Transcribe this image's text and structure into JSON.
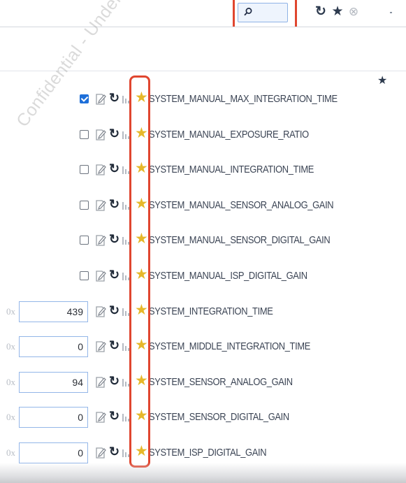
{
  "toolbar": {
    "search": {
      "value": "",
      "placeholder": ""
    },
    "icons": [
      "search-icon",
      "refresh-icon",
      "star-icon",
      "close-icon"
    ]
  },
  "watermark": "Confidential - Under NDA",
  "colors": {
    "accent": "#1e6fd9",
    "star": "#e6b82a",
    "highlight": "#e0462f",
    "text": "#3b4454"
  },
  "parameters": [
    {
      "type": "checkbox",
      "checked": true,
      "name": "SYSTEM_MANUAL_MAX_INTEGRATION_TIME"
    },
    {
      "type": "checkbox",
      "checked": false,
      "name": "SYSTEM_MANUAL_EXPOSURE_RATIO"
    },
    {
      "type": "checkbox",
      "checked": false,
      "name": "SYSTEM_MANUAL_INTEGRATION_TIME"
    },
    {
      "type": "checkbox",
      "checked": false,
      "name": "SYSTEM_MANUAL_SENSOR_ANALOG_GAIN"
    },
    {
      "type": "checkbox",
      "checked": false,
      "name": "SYSTEM_MANUAL_SENSOR_DIGITAL_GAIN"
    },
    {
      "type": "checkbox",
      "checked": false,
      "name": "SYSTEM_MANUAL_ISP_DIGITAL_GAIN"
    },
    {
      "type": "number",
      "prefix": "0x",
      "value": "439",
      "name": "SYSTEM_INTEGRATION_TIME"
    },
    {
      "type": "number",
      "prefix": "0x",
      "value": "0",
      "name": "SYSTEM_MIDDLE_INTEGRATION_TIME"
    },
    {
      "type": "number",
      "prefix": "0x",
      "value": "94",
      "name": "SYSTEM_SENSOR_ANALOG_GAIN"
    },
    {
      "type": "number",
      "prefix": "0x",
      "value": "0",
      "name": "SYSTEM_SENSOR_DIGITAL_GAIN"
    },
    {
      "type": "number",
      "prefix": "0x",
      "value": "0",
      "name": "SYSTEM_ISP_DIGITAL_GAIN"
    }
  ]
}
